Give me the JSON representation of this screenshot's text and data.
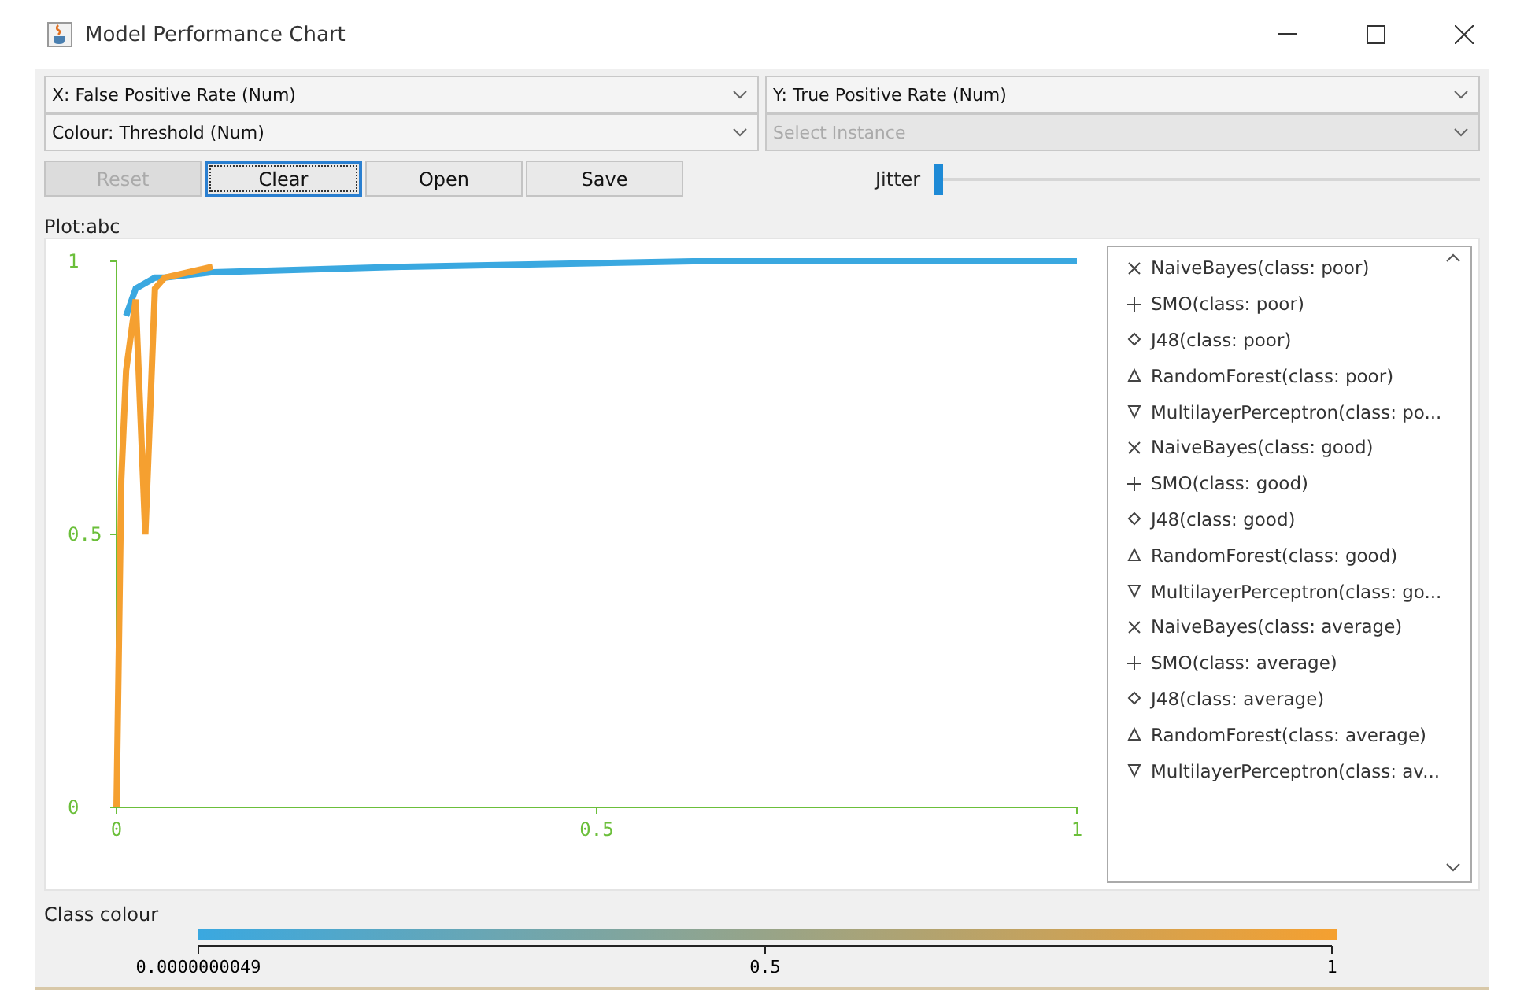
{
  "window": {
    "title": "Model Performance Chart"
  },
  "selectors": [
    {
      "label": "X: False Positive Rate (Num)",
      "disabled": false
    },
    {
      "label": "Y: True Positive Rate (Num)",
      "disabled": false
    },
    {
      "label": "Colour: Threshold (Num)",
      "disabled": false
    },
    {
      "label": "Select Instance",
      "disabled": true
    }
  ],
  "buttons": [
    {
      "label": "Reset",
      "disabled": true,
      "focused": false
    },
    {
      "label": "Clear",
      "disabled": false,
      "focused": true
    },
    {
      "label": "Open",
      "disabled": false,
      "focused": false
    },
    {
      "label": "Save",
      "disabled": false,
      "focused": false
    }
  ],
  "jitter": {
    "label": "Jitter",
    "level": 0
  },
  "plot": {
    "title": "Plot:abc",
    "chart_data": {
      "type": "line",
      "x": [
        0,
        0.005,
        0.01,
        0.02,
        0.03,
        0.04,
        0.05,
        0.1,
        0.3,
        0.6,
        1
      ],
      "series": [
        {
          "color": "#3aa8e0",
          "values": [
            null,
            null,
            0.9,
            0.95,
            0.96,
            0.97,
            0.97,
            0.98,
            0.99,
            1,
            1
          ]
        },
        {
          "color": "#f5a030",
          "values": [
            0,
            0.6,
            0.8,
            0.93,
            0.5,
            0.95,
            0.97,
            0.99,
            null,
            null,
            null
          ]
        }
      ],
      "xlim": [
        0,
        1
      ],
      "ylim": [
        0,
        1
      ],
      "xticks": [
        0,
        0.5,
        1
      ],
      "yticks": [
        0,
        0.5,
        1
      ]
    }
  },
  "legend": [
    {
      "kind": "cross",
      "label": "NaiveBayes(class:  poor)"
    },
    {
      "kind": "plus",
      "label": "SMO(class:  poor)"
    },
    {
      "kind": "diamond",
      "label": "J48(class:  poor)"
    },
    {
      "kind": "triangle-up",
      "label": "RandomForest(class:  poor)"
    },
    {
      "kind": "triangle-down",
      "label": "MultilayerPerceptron(class:  po..."
    },
    {
      "kind": "cross",
      "label": "NaiveBayes(class:  good)"
    },
    {
      "kind": "plus",
      "label": "SMO(class:  good)"
    },
    {
      "kind": "diamond",
      "label": "J48(class:  good)"
    },
    {
      "kind": "triangle-up",
      "label": "RandomForest(class:  good)"
    },
    {
      "kind": "triangle-down",
      "label": "MultilayerPerceptron(class:  go..."
    },
    {
      "kind": "cross",
      "label": "NaiveBayes(class:  average)"
    },
    {
      "kind": "plus",
      "label": "SMO(class:  average)"
    },
    {
      "kind": "diamond",
      "label": "J48(class:  average)"
    },
    {
      "kind": "triangle-up",
      "label": "RandomForest(class:  average)"
    },
    {
      "kind": "triangle-down",
      "label": "MultilayerPerceptron(class:  av..."
    }
  ],
  "class_colour": {
    "title": "Class colour",
    "ticks": [
      "0.0000000049",
      "0.5",
      "1"
    ]
  }
}
